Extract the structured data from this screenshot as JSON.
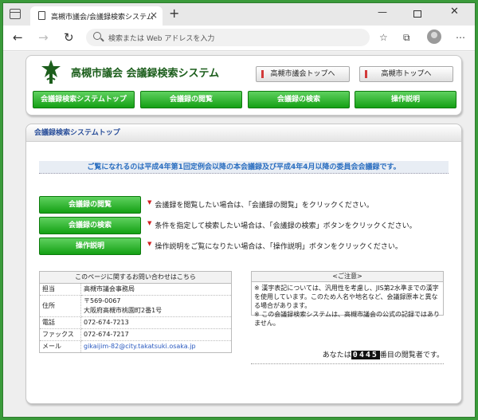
{
  "browser": {
    "tab_title": "高槻市議会/会議録検索システム",
    "tab_close": "×",
    "new_tab": "+",
    "address_placeholder": "検索または Web アドレスを入力",
    "nav": {
      "back": "←",
      "forward": "→",
      "refresh": "↻"
    },
    "window": {
      "minimize": "—",
      "close": "✕"
    },
    "toolbar_icons": {
      "favorites": "☆",
      "collections": "⧉",
      "menu": "⋯"
    }
  },
  "header": {
    "site_title": "高槻市議会 会議録検索システム",
    "top_links": [
      "高槻市議会トップへ",
      "高槻市トップへ"
    ],
    "menu": [
      "会議録検索システムトップ",
      "会議録の閲覧",
      "会議録の検索",
      "操作説明"
    ]
  },
  "main": {
    "section_title": "会議録検索システムトップ",
    "notice": "ご覧になれるのは平成4年第1回定例会以降の本会議録及び平成4年4月以降の委員会会議録です。",
    "actions": [
      {
        "button": "会議録の閲覧",
        "mark": "▼",
        "desc": "会議録を閲覧したい場合は、「会議録の閲覧」をクリックください。"
      },
      {
        "button": "会議録の検索",
        "mark": "▼",
        "desc": "条件を指定して検索したい場合は、「会議録の検索」ボタンをクリックください。"
      },
      {
        "button": "操作説明",
        "mark": "▼",
        "desc": "操作説明をご覧になりたい場合は、「操作説明」ボタンをクリックください。"
      }
    ],
    "contact": {
      "title": "このページに関するお問い合わせはこちら",
      "rows": [
        {
          "label": "担当",
          "value": "高槻市議会事務局"
        },
        {
          "label": "住所",
          "value": "〒569-0067",
          "value2": "大阪府高槻市桃園町2番1号"
        },
        {
          "label": "電話",
          "value": "072-674-7213"
        },
        {
          "label": "ファックス",
          "value": "072-674-7217"
        },
        {
          "label": "メール",
          "value": "gikaijim-82@city.takatsuki.osaka.jp"
        }
      ]
    },
    "notes": {
      "title": "<ご注意>",
      "lines": [
        "※ 漢字表記については、汎用性を考慮し、JIS第2水準までの漢字を使用しています。このため人名や地名など、会議録原本と異なる場合があります。",
        "※ この会議録検索システムは、高槻市議会の公式の記録ではありません。"
      ]
    },
    "counter": {
      "prefix": "あなたは",
      "digits": "0445",
      "suffix": "番目の閲覧者です。"
    }
  },
  "colors": {
    "accent_green": "#14a014",
    "brand_green": "#1c5e1c",
    "notice_blue": "#2a6ec0"
  }
}
